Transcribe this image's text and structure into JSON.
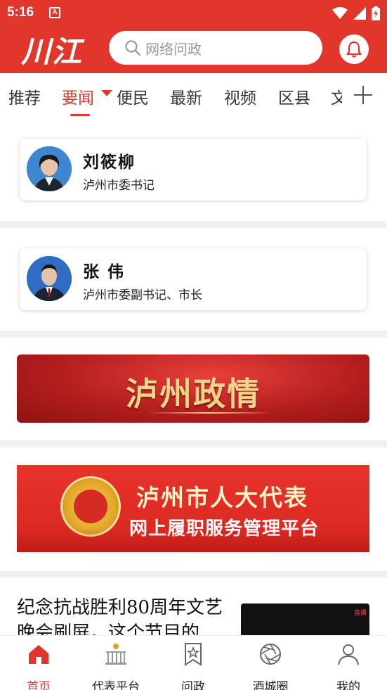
{
  "status_bar": {
    "time": "5:16",
    "a_badge": "A"
  },
  "header": {
    "logo_text": "川江",
    "search_placeholder": "网络问政"
  },
  "tabs": [
    {
      "label": "推荐"
    },
    {
      "label": "要闻"
    },
    {
      "label": "便民"
    },
    {
      "label": "最新"
    },
    {
      "label": "视频"
    },
    {
      "label": "区县"
    },
    {
      "label": "文"
    }
  ],
  "leaders": [
    {
      "name": "刘筱柳",
      "role": "泸州市委书记"
    },
    {
      "name": "张  伟",
      "role": "泸州市委副书记、市长"
    }
  ],
  "banners": {
    "zhengqing": "泸州政情",
    "npc_line1": "泸州市人大代表",
    "npc_line2": "网上履职服务管理平台"
  },
  "news": {
    "title": "纪念抗战胜利80周年文艺晚会刷屏，这个节目的",
    "thumb_tag": "直播"
  },
  "bottom_nav": [
    {
      "label": "首页",
      "icon": "home-icon"
    },
    {
      "label": "代表平台",
      "icon": "hall-icon"
    },
    {
      "label": "问政",
      "icon": "star-bookmark-icon"
    },
    {
      "label": "酒城圈",
      "icon": "aperture-icon"
    },
    {
      "label": "我的",
      "icon": "person-icon"
    }
  ],
  "colors": {
    "brand_red": "#e2362c",
    "gold": "#f1d48a"
  }
}
